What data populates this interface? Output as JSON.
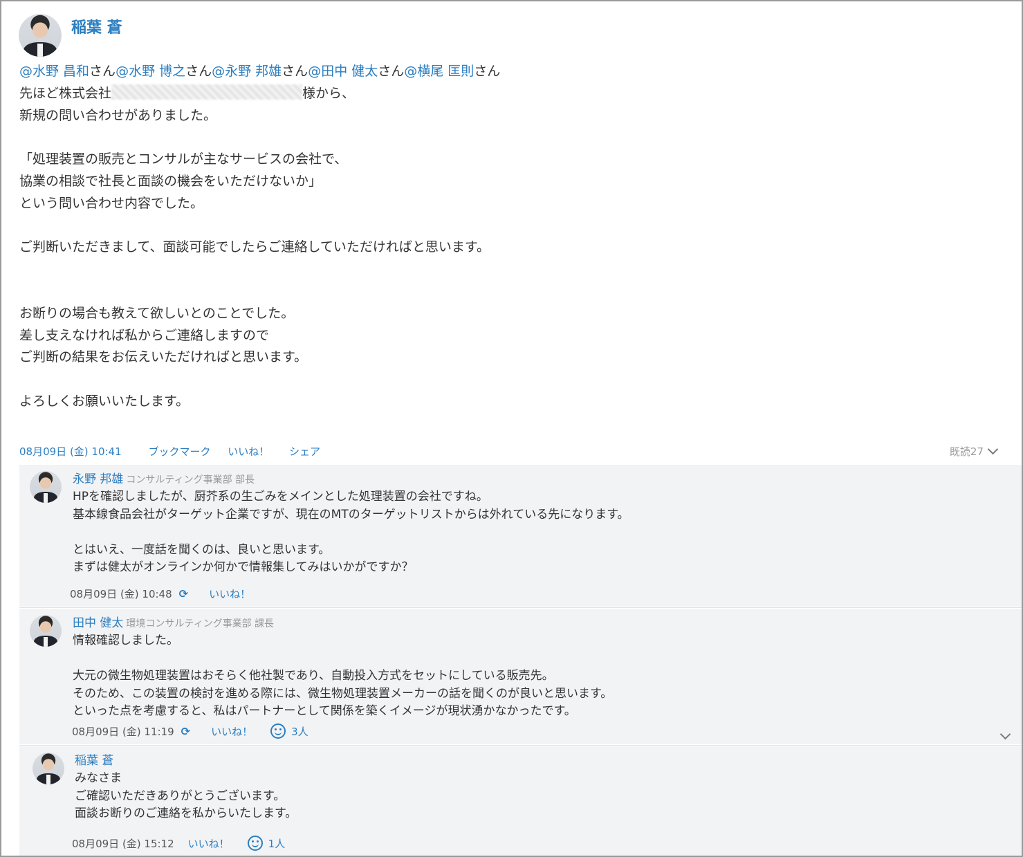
{
  "post": {
    "author": "稲葉 蒼",
    "mentions": [
      "@水野 昌和",
      "@水野 博之",
      "@永野 邦雄",
      "@田中 健太",
      "@横尾 匡則"
    ],
    "mention_suffix": "さん",
    "company_prefix": "先ほど株式会社",
    "company_suffix": "様から、",
    "lines": [
      "新規の問い合わせがありました。",
      "",
      "「処理装置の販売とコンサルが主なサービスの会社で、",
      "協業の相談で社長と面談の機会をいただけないか」",
      "という問い合わせ内容でした。",
      "",
      "ご判断いただきまして、面談可能でしたらご連絡していただければと思います。",
      "",
      "",
      "お断りの場合も教えて欲しいとのことでした。",
      "差し支えなければ私からご連絡しますので",
      "ご判断の結果をお伝えいただければと思います。",
      "",
      "よろしくお願いいたします。"
    ],
    "timestamp": "08月09日 (金) 10:41",
    "bookmark_label": "ブックマーク",
    "like_label": "いいね！",
    "share_label": "シェア",
    "read_count": "既読27"
  },
  "comments": [
    {
      "name": "永野 邦雄",
      "dept": "コンサルティング事業部 部長",
      "lines": [
        "HPを確認しましたが、厨芥系の生ごみをメインとした処理装置の会社ですね。",
        "基本線食品会社がターゲット企業ですが、現在のMTのターゲットリストからは外れている先になります。",
        "",
        "とはいえ、一度話を聞くのは、良いと思います。",
        "まずは健太がオンラインか何かで情報集してみはいかがですか？"
      ],
      "timestamp": "08月09日 (金) 10:48",
      "like_label": "いいね！"
    },
    {
      "name": "田中 健太",
      "dept": "環境コンサルティング事業部 課長",
      "lines": [
        "情報確認しました。",
        "",
        "大元の微生物処理装置はおそらく他社製であり、自動投入方式をセットにしている販売先。",
        "そのため、この装置の検討を進める際には、微生物処理装置メーカーの話を聞くのが良いと思います。",
        " といった点を考慮すると、私はパートナーとして関係を築くイメージが現状湧かなかったです。"
      ],
      "timestamp": "08月09日 (金) 11:19",
      "like_label": "いいね！",
      "reaction_count": "3人"
    },
    {
      "name": "稲葉 蒼",
      "dept": "",
      "lines": [
        "みなさま",
        "ご確認いただきありがとうございます。",
        "面談お断りのご連絡を私からいたします。"
      ],
      "timestamp": "08月09日 (金) 15:12",
      "like_label": "いいね！",
      "reaction_count": "1人"
    }
  ],
  "icons": {
    "sync": "sync-icon",
    "smile": "smile-icon",
    "chevron": "chevron-down-icon"
  },
  "colors": {
    "link": "#2b7ec1",
    "comment_bg": "#f2f3f5",
    "muted": "#9a9a9a"
  }
}
